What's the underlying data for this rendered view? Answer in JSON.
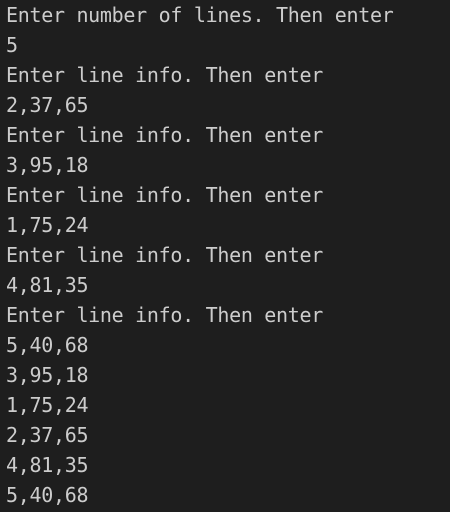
{
  "terminal": {
    "lines": [
      "Enter number of lines. Then enter",
      "5",
      "Enter line info. Then enter",
      "2,37,65",
      "Enter line info. Then enter",
      "3,95,18",
      "Enter line info. Then enter",
      "1,75,24",
      "Enter line info. Then enter",
      "4,81,35",
      "Enter line info. Then enter",
      "5,40,68",
      "3,95,18",
      "1,75,24",
      "2,37,65",
      "4,81,35",
      "5,40,68"
    ]
  }
}
